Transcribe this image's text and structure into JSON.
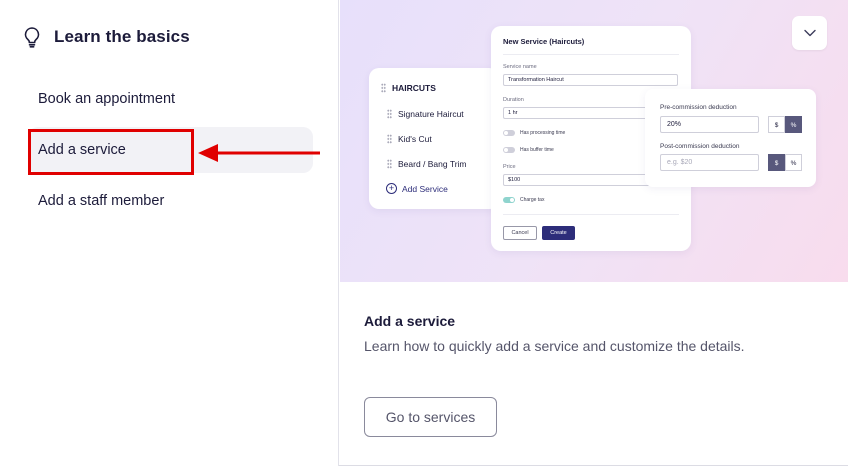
{
  "sidebar": {
    "title": "Learn the basics",
    "items": [
      {
        "label": "Book an appointment"
      },
      {
        "label": "Add a service"
      },
      {
        "label": "Add a staff member"
      }
    ]
  },
  "illustration": {
    "list_card": {
      "heading": "HAIRCUTS",
      "items": [
        "Signature Haircut",
        "Kid's Cut",
        "Beard / Bang Trim"
      ],
      "add_label": "Add Service"
    },
    "form_card": {
      "title": "New Service (Haircuts)",
      "service_name_label": "Service name",
      "service_name_value": "Transformation Haircut",
      "duration_label": "Duration",
      "duration_value": "1 hr",
      "processing_label": "Has processing time",
      "buffer_label": "Has buffer time",
      "price_label": "Price",
      "price_value": "$100",
      "charge_tax_label": "Charge tax",
      "cancel_label": "Cancel",
      "create_label": "Create"
    },
    "commission_card": {
      "pre_label": "Pre-commission deduction",
      "pre_value": "20%",
      "post_label": "Post-commission deduction",
      "post_placeholder": "e.g. $20",
      "dollar": "$",
      "percent": "%"
    }
  },
  "detail": {
    "title": "Add a service",
    "description": "Learn how to quickly add a service and customize the details.",
    "cta_label": "Go to services"
  },
  "colors": {
    "highlight": "#e00000",
    "primary": "#2d2d7a",
    "selected_bg": "#f2f2f6"
  },
  "icons": [
    "lightbulb-icon",
    "chevron-down-icon",
    "grip-icon",
    "plus-circle-icon"
  ]
}
